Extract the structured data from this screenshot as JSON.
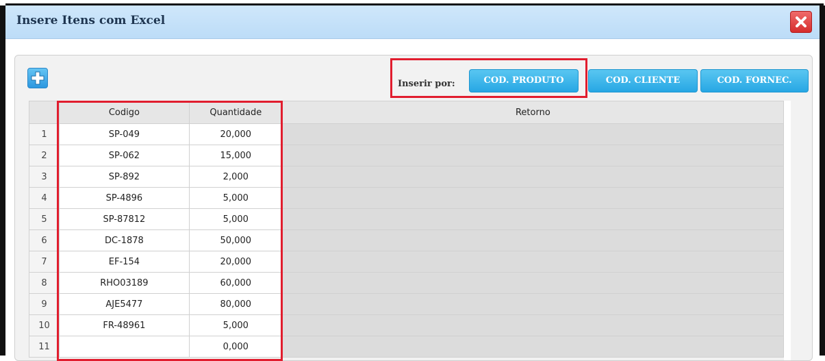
{
  "dialog": {
    "title": "Insere Itens com Excel"
  },
  "toolbar": {
    "inserir_label": "Inserir por:",
    "buttons": [
      "COD. PRODUTO",
      "COD. CLIENTE",
      "COD. FORNEC."
    ]
  },
  "grid": {
    "headers": [
      "Codigo",
      "Quantidade",
      "Retorno"
    ],
    "rows": [
      {
        "n": "1",
        "codigo": "SP-049",
        "quantidade": "20,000",
        "retorno": ""
      },
      {
        "n": "2",
        "codigo": "SP-062",
        "quantidade": "15,000",
        "retorno": ""
      },
      {
        "n": "3",
        "codigo": "SP-892",
        "quantidade": "2,000",
        "retorno": ""
      },
      {
        "n": "4",
        "codigo": "SP-4896",
        "quantidade": "5,000",
        "retorno": ""
      },
      {
        "n": "5",
        "codigo": "SP-87812",
        "quantidade": "5,000",
        "retorno": ""
      },
      {
        "n": "6",
        "codigo": "DC-1878",
        "quantidade": "50,000",
        "retorno": ""
      },
      {
        "n": "7",
        "codigo": "EF-154",
        "quantidade": "20,000",
        "retorno": ""
      },
      {
        "n": "8",
        "codigo": "RHO03189",
        "quantidade": "60,000",
        "retorno": ""
      },
      {
        "n": "9",
        "codigo": "AJE5477",
        "quantidade": "80,000",
        "retorno": ""
      },
      {
        "n": "10",
        "codigo": "FR-48961",
        "quantidade": "5,000",
        "retorno": ""
      },
      {
        "n": "11",
        "codigo": "",
        "quantidade": "0,000",
        "retorno": ""
      }
    ]
  },
  "colors": {
    "accent": "#27a7e4",
    "highlight": "#e11d2e",
    "title_bar": "#bcdcf7",
    "close": "#d62d2d"
  },
  "icons": [
    "close-icon",
    "plus-icon"
  ]
}
